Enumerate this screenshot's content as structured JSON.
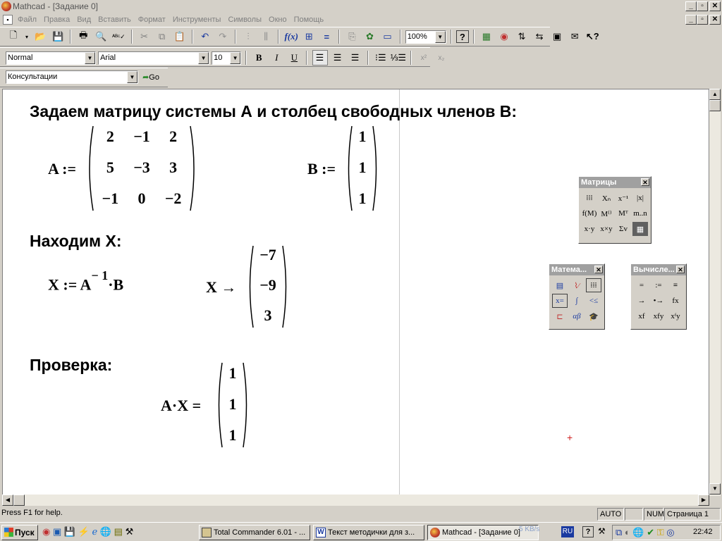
{
  "window": {
    "title": "Mathcad - [Задание 0]"
  },
  "menu": [
    "Файл",
    "Правка",
    "Вид",
    "Вставить",
    "Формат",
    "Инструменты",
    "Символы",
    "Окно",
    "Помощь"
  ],
  "toolbar": {
    "zoom": "100%"
  },
  "format_bar": {
    "style": "Normal",
    "font": "Arial",
    "size": "10",
    "bold": "B",
    "italic": "I",
    "underline": "U"
  },
  "resource_bar": {
    "resource": "Консультации",
    "go_label": "Go"
  },
  "worksheet": {
    "heading1": "Задаем матрицу системы А и столбец свободных членов В:",
    "a_def": "A :=",
    "matrix_a": [
      [
        "2",
        "−1",
        "2"
      ],
      [
        "5",
        "−3",
        "3"
      ],
      [
        "−1",
        "0",
        "−2"
      ]
    ],
    "b_def": "B :=",
    "vector_b": [
      "1",
      "1",
      "1"
    ],
    "heading2": "Находим X:",
    "x_def_lhs": "X := A",
    "x_def_exp": "− 1",
    "x_def_rhs": "·B",
    "x_eval": "X →",
    "vector_x": [
      "−7",
      "−9",
      "3"
    ],
    "heading3": "Проверка:",
    "check": "A·X =",
    "vector_check": [
      "1",
      "1",
      "1"
    ]
  },
  "palettes": {
    "matrices": {
      "title": "Матрицы"
    },
    "math": {
      "title": "Матема..."
    },
    "evaluation": {
      "title": "Вычисле...",
      "buttons": [
        "=",
        ":=",
        "≡",
        "→",
        "•→",
        "fx",
        "xf",
        "xfy",
        "xᶠy"
      ]
    }
  },
  "statusbar": {
    "help": "Press F1 for help.",
    "mode": "AUTO",
    "num": "NUM",
    "page": "Страница 1"
  },
  "taskbar": {
    "start": "Пуск",
    "tasks": [
      "Total Commander 6.01 - ...",
      "Текст методички для з...",
      "Mathcad - [Задание 0]"
    ],
    "network": "5 KB/s",
    "lang": "RU",
    "clock": "22:42"
  }
}
